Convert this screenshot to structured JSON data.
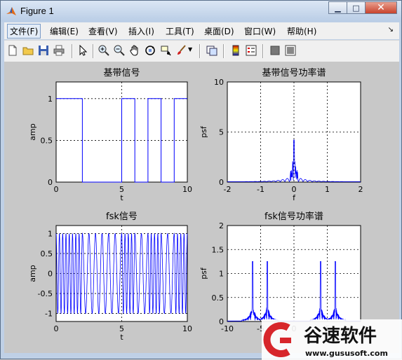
{
  "window": {
    "title": "Figure 1"
  },
  "menus": [
    "文件(F)",
    "编辑(E)",
    "查看(V)",
    "插入(I)",
    "工具(T)",
    "桌面(D)",
    "窗口(W)",
    "帮助(H)"
  ],
  "toolbar": [
    "new-file-icon",
    "open-folder-icon",
    "save-icon",
    "print-icon",
    "pointer-icon",
    "zoom-in-icon",
    "zoom-out-icon",
    "pan-hand-icon",
    "rotate-3d-icon",
    "data-cursor-icon",
    "brush-icon",
    "link-plot-icon",
    "colorbar-icon",
    "legend-icon",
    "hide-plot-tools-icon",
    "show-plot-tools-icon"
  ],
  "axes": [
    {
      "title": "基带信号",
      "xlabel": "t",
      "ylabel": "amp",
      "xticks": [
        "0",
        "5",
        "10"
      ],
      "yticks": [
        "0",
        "0.5",
        "1"
      ]
    },
    {
      "title": "基带信号功率谱",
      "xlabel": "f",
      "ylabel": "psf",
      "xticks": [
        "-2",
        "-1",
        "0",
        "1",
        "2"
      ],
      "yticks": [
        "0",
        "5",
        "10"
      ]
    },
    {
      "title": "fsk信号",
      "xlabel": "t",
      "ylabel": "amp",
      "xticks": [
        "0",
        "5",
        "10"
      ],
      "yticks": [
        "-1",
        "-0.5",
        "0",
        "0.5",
        "1"
      ]
    },
    {
      "title": "fsk信号功率谱",
      "xlabel": "",
      "ylabel": "psf",
      "xticks": [
        "-10",
        "-5",
        "0",
        "5"
      ],
      "yticks": [
        "0",
        "0.5",
        "1",
        "1.5",
        "2"
      ]
    }
  ],
  "chart_data": [
    {
      "type": "line",
      "title": "基带信号",
      "xlabel": "t",
      "ylabel": "amp",
      "xlim": [
        0,
        10
      ],
      "ylim": [
        0,
        1.2
      ],
      "grid": true,
      "series": [
        {
          "x": [
            0,
            2,
            2,
            5,
            5,
            6,
            6,
            7,
            7,
            8,
            8,
            9,
            9,
            10
          ],
          "values": [
            1,
            1,
            0,
            0,
            1,
            1,
            0,
            0,
            1,
            1,
            0,
            0,
            1,
            1
          ]
        }
      ]
    },
    {
      "type": "line",
      "title": "基带信号功率谱",
      "xlabel": "f",
      "ylabel": "psf",
      "xlim": [
        -2,
        2
      ],
      "ylim": [
        0,
        10
      ],
      "grid": true,
      "series": [
        {
          "x": [
            -2,
            -0.6,
            -0.4,
            -0.2,
            -0.1,
            -0.05,
            0,
            0.05,
            0.1,
            0.2,
            0.4,
            0.6,
            2
          ],
          "values": [
            0,
            0.1,
            0.3,
            0.5,
            1,
            2,
            4.2,
            2,
            1,
            0.5,
            0.3,
            0.1,
            0
          ]
        }
      ]
    },
    {
      "type": "line",
      "title": "fsk信号",
      "xlabel": "t",
      "ylabel": "amp",
      "xlim": [
        0,
        10
      ],
      "ylim": [
        -1.2,
        1.2
      ],
      "grid": true,
      "series": [
        {
          "x": [
            0,
            10
          ],
          "values": [
            -1,
            1
          ]
        }
      ]
    },
    {
      "type": "line",
      "title": "fsk信号功率谱",
      "xlabel": "",
      "ylabel": "psf",
      "xlim": [
        -10,
        10
      ],
      "ylim": [
        0,
        2
      ],
      "grid": true,
      "series": [
        {
          "x": [
            -8,
            -7,
            -6.2,
            -4,
            -3,
            0,
            3,
            4,
            5,
            6.2
          ],
          "values": [
            0,
            0.35,
            1.25,
            1.25,
            0.35,
            0,
            0.35,
            1.25,
            1.25,
            0
          ]
        }
      ]
    }
  ],
  "watermark": {
    "brand": "谷速软件",
    "url": "www.gususoft.com"
  },
  "colors": {
    "line": "#0000ff",
    "figure_bg": "#c8c8c8",
    "axes_bg": "#ffffff"
  }
}
